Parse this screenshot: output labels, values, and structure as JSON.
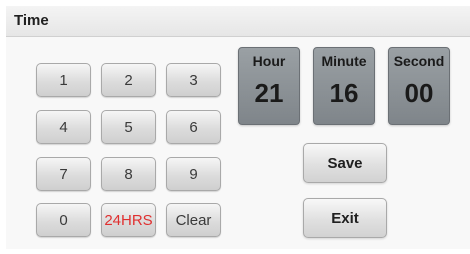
{
  "header": {
    "title": "Time"
  },
  "keypad": {
    "k1": "1",
    "k2": "2",
    "k3": "3",
    "k4": "4",
    "k5": "5",
    "k6": "6",
    "k7": "7",
    "k8": "8",
    "k9": "9",
    "k0": "0",
    "mode": "24HRS",
    "clear": "Clear"
  },
  "time": {
    "hour_label": "Hour",
    "hour": "21",
    "minute_label": "Minute",
    "minute": "16",
    "second_label": "Second",
    "second": "00"
  },
  "actions": {
    "save": "Save",
    "exit": "Exit"
  },
  "colors": {
    "mode_text": "#e03030",
    "tile": "#8a9095"
  }
}
